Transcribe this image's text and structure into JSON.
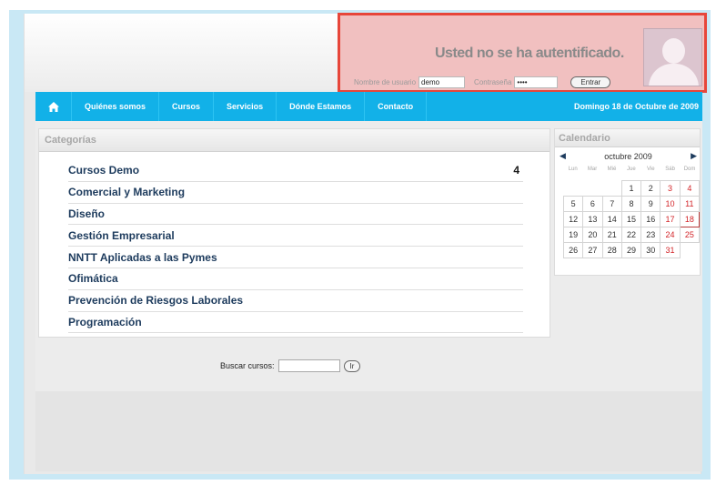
{
  "login": {
    "title": "Usted no se ha autentificado.",
    "username_label": "Nombre de usuario",
    "username_value": "demo",
    "password_label": "Contraseña",
    "password_value": "••••",
    "submit_label": "Entrar"
  },
  "nav": {
    "home_icon": "home-icon",
    "items": [
      "Quiénes somos",
      "Cursos",
      "Servicios",
      "Dónde Estamos",
      "Contacto"
    ],
    "date": "Domingo 18 de Octubre de 2009"
  },
  "categories": {
    "title": "Categorías",
    "items": [
      {
        "label": "Cursos Demo",
        "count": "4"
      },
      {
        "label": "Comercial y Marketing",
        "count": ""
      },
      {
        "label": "Diseño",
        "count": ""
      },
      {
        "label": "Gestión Empresarial",
        "count": ""
      },
      {
        "label": "NNTT Aplicadas a las Pymes",
        "count": ""
      },
      {
        "label": "Ofimática",
        "count": ""
      },
      {
        "label": "Prevención de Riesgos Laborales",
        "count": ""
      },
      {
        "label": "Programación",
        "count": ""
      }
    ]
  },
  "calendar": {
    "title": "Calendario",
    "month": "octubre 2009",
    "prev_icon": "◀",
    "next_icon": "▶",
    "weekdays": [
      "Lun",
      "Mar",
      "Mié",
      "Jue",
      "Vie",
      "Sáb",
      "Dom"
    ],
    "weeks": [
      [
        "",
        "",
        "",
        "1",
        "2",
        "3",
        "4"
      ],
      [
        "5",
        "6",
        "7",
        "8",
        "9",
        "10",
        "11"
      ],
      [
        "12",
        "13",
        "14",
        "15",
        "16",
        "17",
        "18"
      ],
      [
        "19",
        "20",
        "21",
        "22",
        "23",
        "24",
        "25"
      ],
      [
        "26",
        "27",
        "28",
        "29",
        "30",
        "31",
        ""
      ]
    ],
    "today": "18",
    "weekend_color": "#d3262a"
  },
  "search": {
    "label": "Buscar cursos:",
    "button_label": "Ir",
    "value": ""
  },
  "colors": {
    "nav_bg": "#12b1e8",
    "login_highlight": "#e7463a"
  }
}
